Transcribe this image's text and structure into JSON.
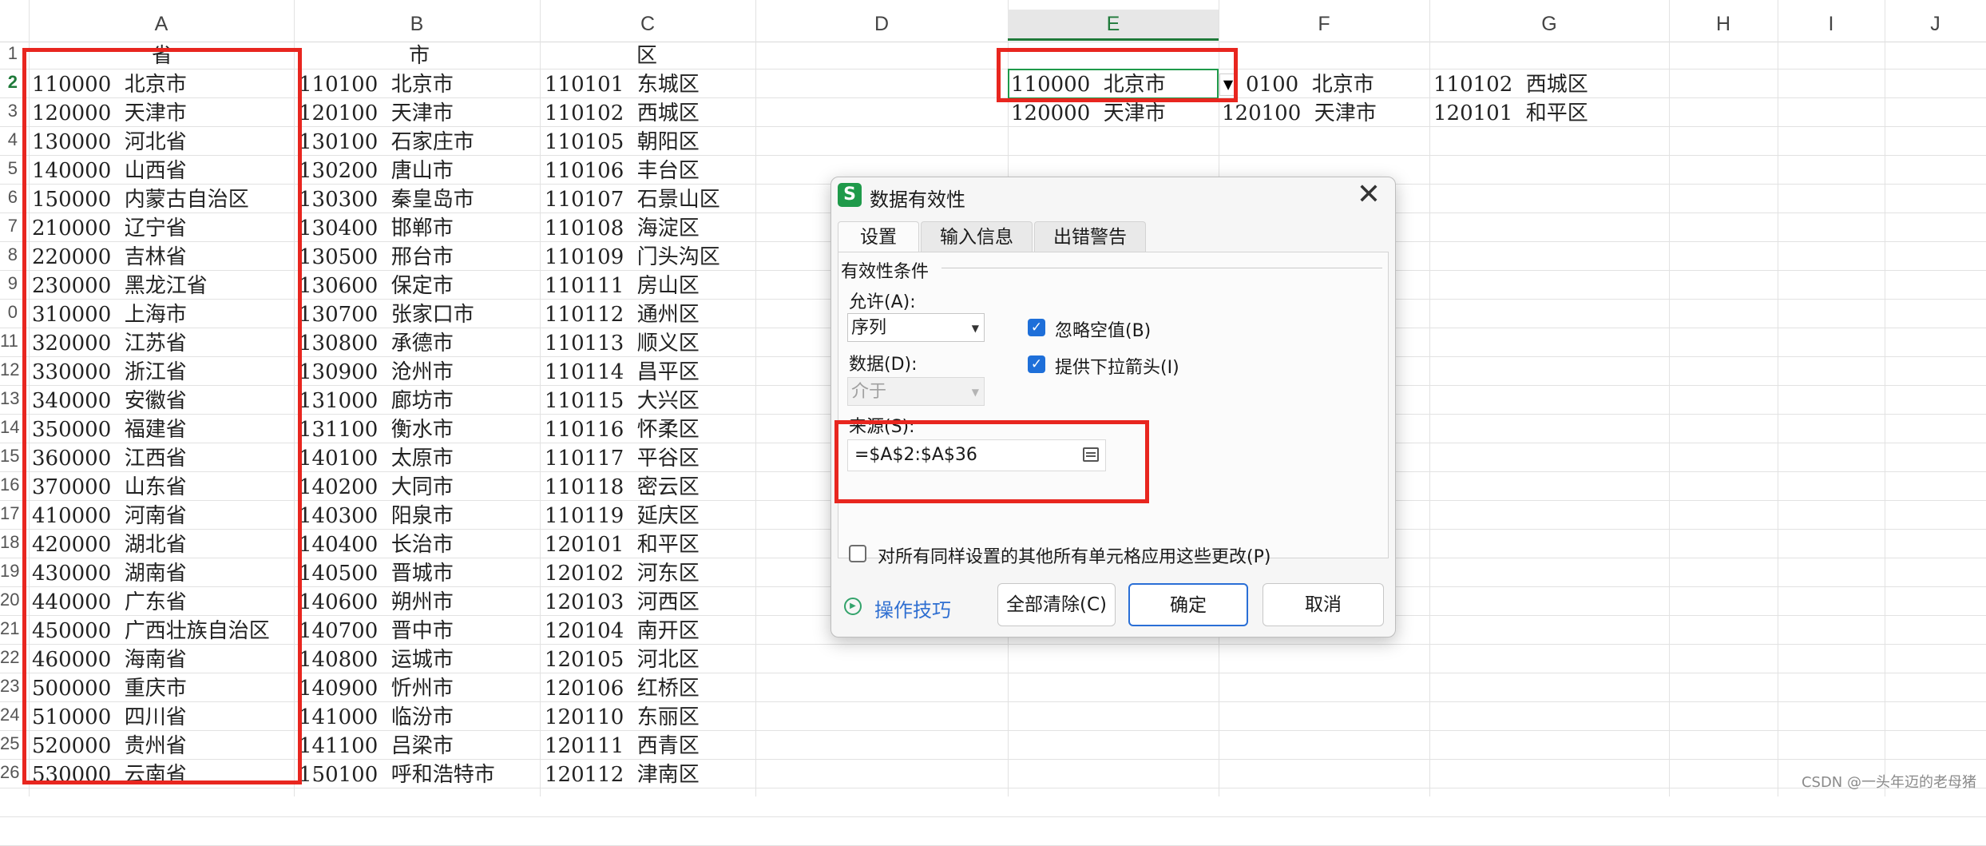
{
  "sheet": {
    "columns": [
      "A",
      "B",
      "C",
      "D",
      "E",
      "F",
      "G",
      "H",
      "I",
      "J"
    ],
    "active_column": "E",
    "active_row": "2",
    "row_numbers": [
      "1",
      "2",
      "3",
      "4",
      "5",
      "6",
      "7",
      "8",
      "9",
      "0",
      "11",
      "12",
      "13",
      "14",
      "15",
      "16",
      "17",
      "18",
      "19",
      "20",
      "21",
      "22",
      "23",
      "24",
      "25",
      "26"
    ],
    "header_row": {
      "a": "省",
      "b": "市",
      "c": "区"
    },
    "col_a": [
      "110000  北京市",
      "120000  天津市",
      "130000  河北省",
      "140000  山西省",
      "150000  内蒙古自治区",
      "210000  辽宁省",
      "220000  吉林省",
      "230000  黑龙江省",
      "310000  上海市",
      "320000  江苏省",
      "330000  浙江省",
      "340000  安徽省",
      "350000  福建省",
      "360000  江西省",
      "370000  山东省",
      "410000  河南省",
      "420000  湖北省",
      "430000  湖南省",
      "440000  广东省",
      "450000  广西壮族自治区",
      "460000  海南省",
      "500000  重庆市",
      "510000  四川省",
      "520000  贵州省",
      "530000  云南省"
    ],
    "col_b": [
      "110100  北京市",
      "120100  天津市",
      "130100  石家庄市",
      "130200  唐山市",
      "130300  秦皇岛市",
      "130400  邯郸市",
      "130500  邢台市",
      "130600  保定市",
      "130700  张家口市",
      "130800  承德市",
      "130900  沧州市",
      "131000  廊坊市",
      "131100  衡水市",
      "140100  太原市",
      "140200  大同市",
      "140300  阳泉市",
      "140400  长治市",
      "140500  晋城市",
      "140600  朔州市",
      "140700  晋中市",
      "140800  运城市",
      "140900  忻州市",
      "141000  临汾市",
      "141100  吕梁市",
      "150100  呼和浩特市"
    ],
    "col_c": [
      "110101  东城区",
      "110102  西城区",
      "110105  朝阳区",
      "110106  丰台区",
      "110107  石景山区",
      "110108  海淀区",
      "110109  门头沟区",
      "110111  房山区",
      "110112  通州区",
      "110113  顺义区",
      "110114  昌平区",
      "110115  大兴区",
      "110116  怀柔区",
      "110117  平谷区",
      "110118  密云区",
      "110119  延庆区",
      "120101  和平区",
      "120102  河东区",
      "120103  河西区",
      "120104  南开区",
      "120105  河北区",
      "120106  红桥区",
      "120110  东丽区",
      "120111  西青区",
      "120112  津南区"
    ],
    "e2": "110000  北京市",
    "f2": "0100  北京市",
    "g2": "110102  西城区",
    "e3": "120000  天津市",
    "f3": "120100  天津市",
    "g3": "120101  和平区"
  },
  "dialog": {
    "title": "数据有效性",
    "app_icon_letter": "S",
    "close_glyph": "✕",
    "tabs": [
      "设置",
      "输入信息",
      "出错警告"
    ],
    "group_label": "有效性条件",
    "allow_label": "允许(A):",
    "allow_value": "序列",
    "data_label": "数据(D):",
    "data_value": "介于",
    "ignore_blank_label": "忽略空值(B)",
    "dropdown_arrow_label": "提供下拉箭头(I)",
    "source_label": "来源(S):",
    "source_value": "=$A$2:$A$36",
    "apply_all_label": "对所有同样设置的其他所有单元格应用这些更改(P)",
    "tips_label": "操作技巧",
    "clear_all_label": "全部清除(C)",
    "ok_label": "确定",
    "cancel_label": "取消"
  },
  "colors": {
    "accent_green": "#1f9a4a",
    "highlight_red": "#e8261f",
    "primary_blue": "#2a6fd6"
  },
  "watermark": "CSDN @一头年迈的老母猪"
}
